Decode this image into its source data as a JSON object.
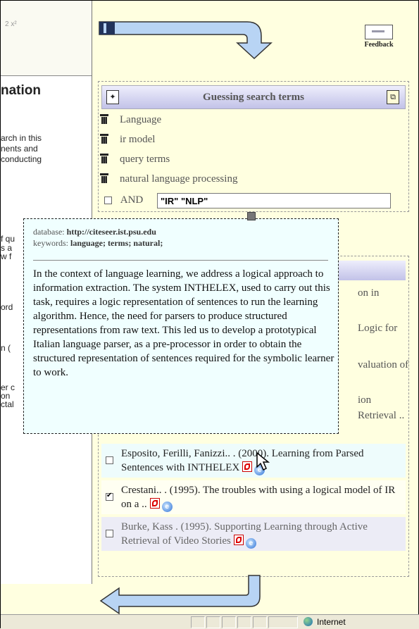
{
  "left_panel": {
    "toolbar_glyphs": "2  x²",
    "heading": "nation",
    "text_lines": [
      "arch in this",
      "nents and",
      "conducting"
    ],
    "fragments": [
      "f qu",
      "s a",
      "w f",
      "ord",
      "n (",
      "er c",
      "on",
      "ctal"
    ]
  },
  "feedback": {
    "label": "Feedback",
    "icon": "envelope-icon"
  },
  "guess_box": {
    "title": "Guessing search terms",
    "terms": [
      "Language",
      "ir model",
      "query terms",
      "natural language processing"
    ],
    "and_label": "AND",
    "query_value": "\"IR\" \"NLP\""
  },
  "tooltip": {
    "database_label": "database:",
    "database_value": "http://citeseer.ist.psu.edu",
    "keywords_label": "keywords:",
    "keywords_value": "language; terms; natural;",
    "abstract": "In the context of language learning, we address a logical approach to information extraction. The system INTHELEX, used to carry out this task, requires a logic representation of sentences to run the learning algorithm. Hence, the need for parsers to produce structured representations from raw text. This led us to develop a prototypical Italian language parser, as a pre-processor in order to obtain the structured representation of sentences required for the symbolic learner to work."
  },
  "results": {
    "partial_texts": [
      "on in",
      "Logic for",
      "valuation of",
      "ion",
      "Retrieval .."
    ],
    "items": [
      {
        "text": "Esposito, Ferilli, Fanizzi.. . (2000). Learning from Parsed Sentences with INTHELEX",
        "checked": false
      },
      {
        "text": "Crestani.. . (1995). The troubles with using a logical model of IR on a ..",
        "checked": true
      },
      {
        "text": "Burke, Kass . (1995). Supporting Learning through Active Retrieval of Video Stories",
        "checked": false
      }
    ]
  },
  "status_bar": {
    "zone": "Internet"
  },
  "colors": {
    "background": "#ffffe0",
    "header_gradient_top": "#eeeefc",
    "header_gradient_bottom": "#c2c2e8",
    "tooltip_bg": "#f0ffff",
    "arrow_fill": "#b8d4f4"
  }
}
